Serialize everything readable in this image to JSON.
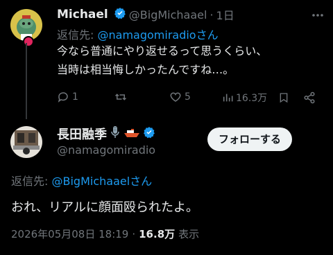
{
  "reply_tweet": {
    "name": "Michael",
    "handle": "@BigMichaael",
    "dot": "·",
    "time": "1日",
    "replying_prefix": "返信先:",
    "replying_to": "@namagomiradio",
    "replying_suffix": "さん",
    "text_lines": [
      "今なら普通にやり返せるって思うくらい、",
      "当時は相当悔しかったんですね…。"
    ],
    "actions": {
      "reply_count": "1",
      "retweet_count": "",
      "like_count": "5",
      "view_count": "16.3万"
    }
  },
  "main_tweet": {
    "name": "長田融季",
    "handle": "@namagomiradio",
    "follow_label": "フォローする",
    "replying_prefix": "返信先:",
    "replying_to": "@BigMichaael",
    "replying_suffix": "さん",
    "text": "おれ、リアルに顔面殴られたよ。",
    "timestamp": "2026年05月08日 18:19",
    "dot": "·",
    "views": "16.8万",
    "views_label": "表示"
  },
  "colors": {
    "background": "#000000",
    "text": "#e7e9ea",
    "muted": "#71767b",
    "link": "#1d9bf0",
    "verified": "#1d9bf0"
  }
}
